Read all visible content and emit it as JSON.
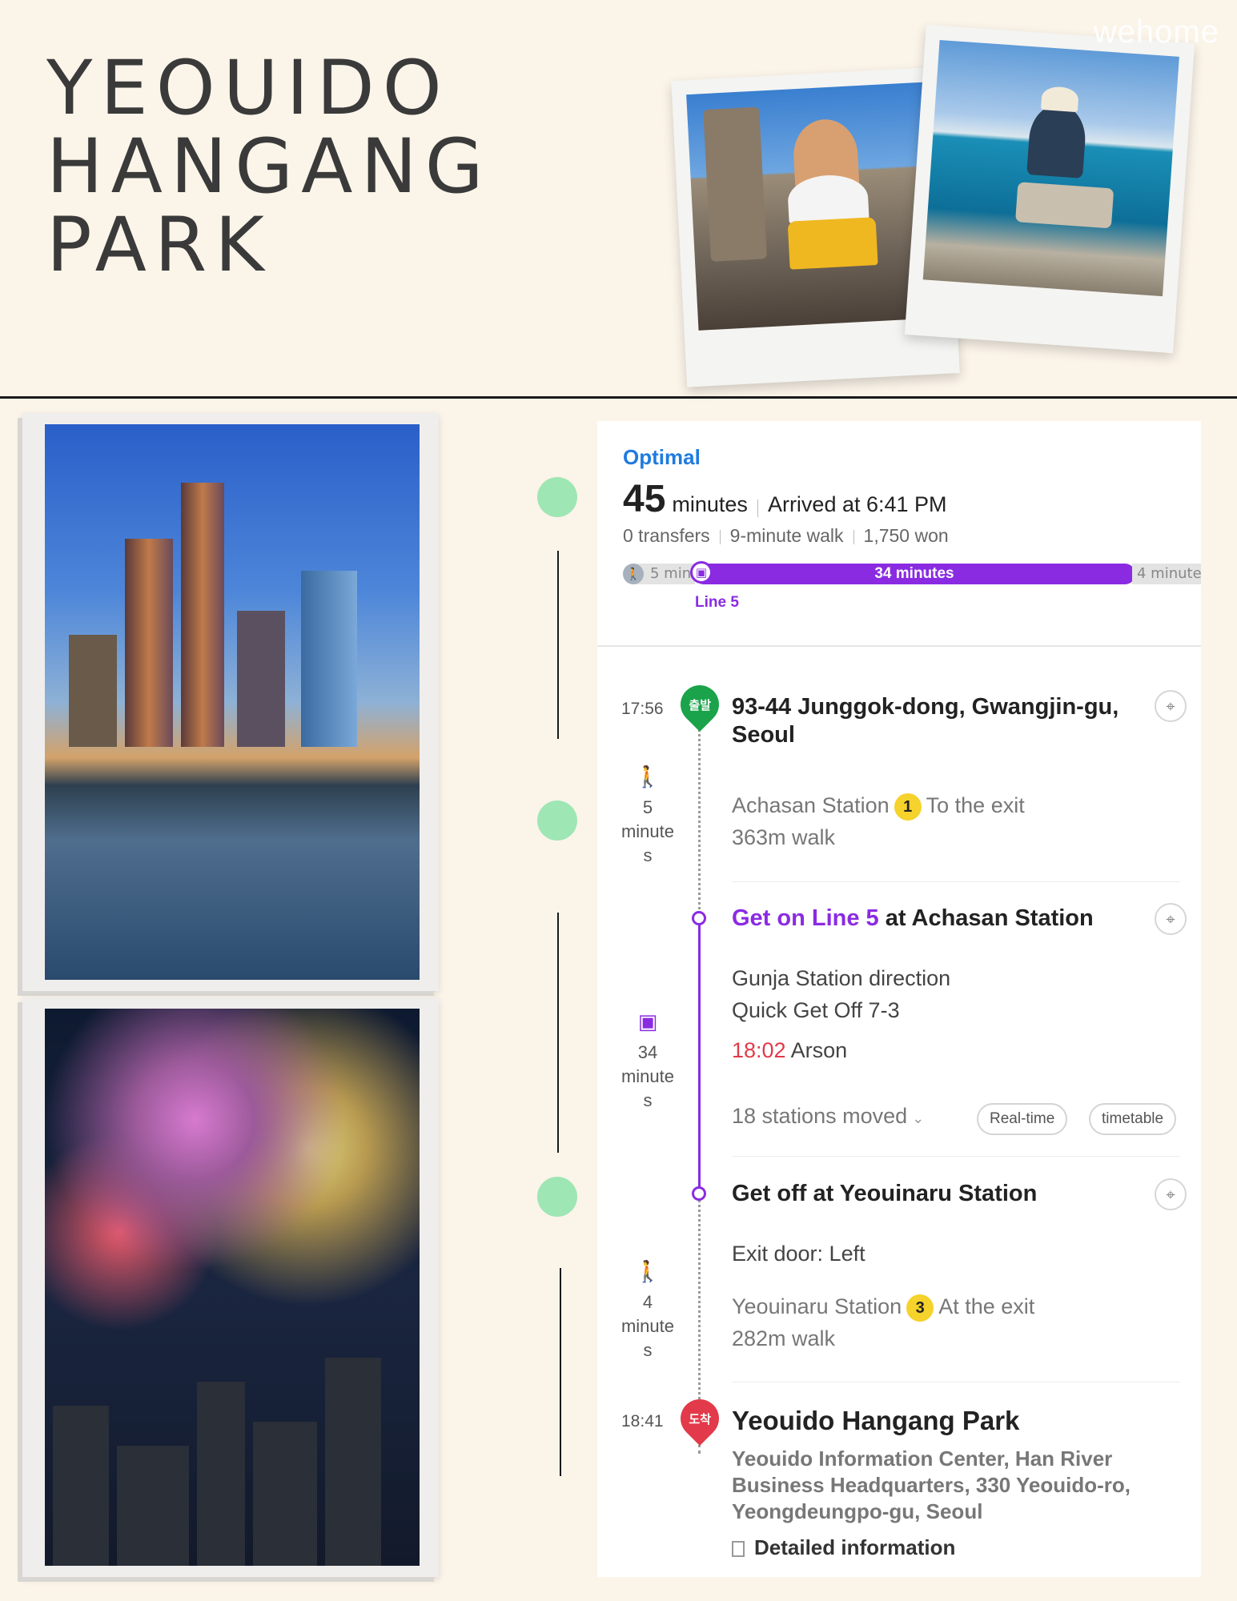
{
  "header": {
    "title_lines": [
      "YEOUIDO",
      "HANGANG",
      "PARK"
    ],
    "brand": "wehome"
  },
  "colors": {
    "background": "#fbf4e9",
    "accent_blue": "#1f7be0",
    "line5_purple": "#8a2be2",
    "start_green": "#1aa34a",
    "end_red": "#e23a4a",
    "timeline_dot": "#9ee6b4",
    "badge_yellow": "#f5d22c"
  },
  "route": {
    "label": "Optimal",
    "duration_value": "45",
    "duration_unit": "minutes",
    "arrival": "Arrived at 6:41 PM",
    "transfers": "0 transfers",
    "walk": "9-minute walk",
    "fare": "1,750 won",
    "bar": {
      "walk_start": "5 min",
      "subway": "34 minutes",
      "walk_end": "4 minute",
      "line_label": "Line 5"
    }
  },
  "steps": {
    "start": {
      "time": "17:56",
      "pin_label": "출발",
      "address": "93-44 Junggok-dong, Gwangjin-gu, Seoul"
    },
    "walk1": {
      "icon": "walking-icon",
      "duration_lines": [
        "5",
        "minute",
        "s"
      ],
      "station": "Achasan Station",
      "exit_number": "1",
      "exit_text": "To  the exit",
      "distance": "363m walk"
    },
    "board": {
      "line_label": "Get on Line 5",
      "station_text": "at Achasan Station",
      "direction": "Gunja Station direction",
      "quick_off": "Quick Get Off 7-3",
      "depart_time": "18:02",
      "depart_note": "Arson",
      "stations_moved": "18 stations moved",
      "realtime_btn": "Real-time",
      "timetable_btn": "timetable",
      "side_icon": "subway-icon",
      "duration_lines": [
        "34",
        "minute",
        "s"
      ]
    },
    "alight": {
      "title": "Get off at Yeouinaru Station",
      "door": "Exit door: Left"
    },
    "walk2": {
      "icon": "walking-icon",
      "duration_lines": [
        "4",
        "minute",
        "s"
      ],
      "station": "Yeouinaru Station",
      "exit_number": "3",
      "exit_text": "At  the exit",
      "distance": "282m walk"
    },
    "end": {
      "time": "18:41",
      "pin_label": "도착",
      "name": "Yeouido Hangang Park",
      "address": "Yeouido Information Center, Han River Business Headquarters, 330 Yeouido-ro, Yeongdeungpo-gu, Seoul",
      "detail": "Detailed information"
    }
  }
}
